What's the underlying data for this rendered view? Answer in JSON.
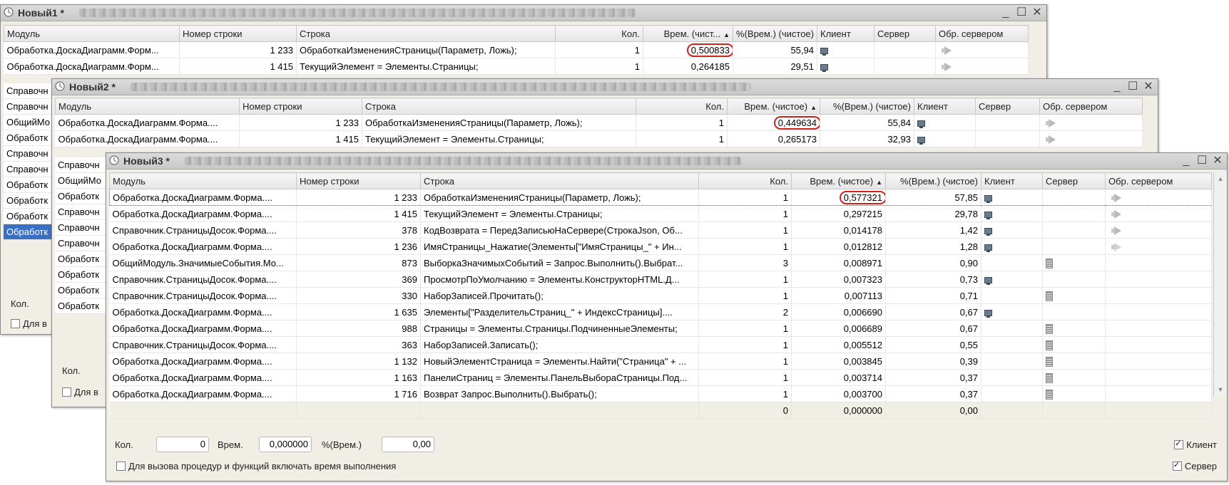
{
  "columns": [
    "Модуль",
    "Номер строки",
    "Строка",
    "Кол.",
    "Врем. (чистое)",
    "%(Врем.) (чистое)",
    "Клиент",
    "Сервер",
    "Обр. сервером"
  ],
  "columns_w1": [
    "Модуль",
    "Номер строки",
    "Строка",
    "Кол.",
    "Врем. (чист...",
    "%(Врем.) (чистое)",
    "Клиент",
    "Сервер",
    "Обр. сервером"
  ],
  "window1": {
    "title": "Новый1 *",
    "rows": [
      {
        "module": "Обработка.ДоскаДиаграмм.Форм...",
        "line": "1 233",
        "code": "ОбработкаИзмененияСтраницы(Параметр, Ложь);",
        "count": "1",
        "time": "0,500833",
        "pct": "55,94",
        "client": true,
        "srv": "arrow"
      },
      {
        "module": "Обработка.ДоскаДиаграмм.Форм...",
        "line": "1 415",
        "code": "ТекущийЭлемент = Элементы.Страницы;",
        "count": "1",
        "time": "0,264185",
        "pct": "29,51",
        "client": true,
        "srv": "arrow"
      }
    ],
    "left_items": [
      "Справочн",
      "Справочн",
      "ОбщийМо",
      "Обработк",
      "Справочн",
      "Справочн",
      "Обработк",
      "Обработк",
      "Обработк",
      "Обработк"
    ],
    "footer_label": "Кол.",
    "footer_checkbox": "Для в"
  },
  "window2": {
    "title": "Новый2 *",
    "rows": [
      {
        "module": "Обработка.ДоскаДиаграмм.Форма....",
        "line": "1 233",
        "code": "ОбработкаИзмененияСтраницы(Параметр, Ложь);",
        "count": "1",
        "time": "0,449634",
        "pct": "55,84",
        "client": true,
        "srv": "arrow"
      },
      {
        "module": "Обработка.ДоскаДиаграмм.Форма....",
        "line": "1 415",
        "code": "ТекущийЭлемент = Элементы.Страницы;",
        "count": "1",
        "time": "0,265173",
        "pct": "32,93",
        "client": true,
        "srv": "arrow"
      }
    ],
    "left_items": [
      "Справочн",
      "ОбщийМо",
      "Обработк",
      "Справочн",
      "Справочн",
      "Справочн",
      "Обработк",
      "Обработк",
      "Обработк",
      "Обработк"
    ],
    "footer_label": "Кол.",
    "footer_checkbox": "Для в"
  },
  "window3": {
    "title": "Новый3 *",
    "rows": [
      {
        "module": "Обработка.ДоскаДиаграмм.Форма....",
        "line": "1 233",
        "code": "ОбработкаИзмененияСтраницы(Параметр, Ложь);",
        "count": "1",
        "time": "0,577321",
        "pct": "57,85",
        "client": true,
        "srv": "arrow"
      },
      {
        "module": "Обработка.ДоскаДиаграмм.Форма....",
        "line": "1 415",
        "code": "ТекущийЭлемент = Элементы.Страницы;",
        "count": "1",
        "time": "0,297215",
        "pct": "29,78",
        "client": true,
        "srv": "arrow"
      },
      {
        "module": "Справочник.СтраницыДосок.Форма....",
        "line": "378",
        "code": "КодВозврата = ПередЗаписьюНаСервере(СтрокаJson, Об...",
        "count": "1",
        "time": "0,014178",
        "pct": "1,42",
        "client": true,
        "srv": "arrow"
      },
      {
        "module": "Обработка.ДоскаДиаграмм.Форма....",
        "line": "1 236",
        "code": "ИмяСтраницы_Нажатие(Элементы[\"ИмяСтраницы_\" + Ин...",
        "count": "1",
        "time": "0,012812",
        "pct": "1,28",
        "client": true,
        "srv": "arrow-light"
      },
      {
        "module": "ОбщийМодуль.ЗначимыеСобытия.Мо...",
        "line": "873",
        "code": "ВыборкаЗначимыхСобытий = Запрос.Выполнить().Выбрат...",
        "count": "3",
        "time": "0,008971",
        "pct": "0,90",
        "client": false,
        "srv": "server"
      },
      {
        "module": "Справочник.СтраницыДосок.Форма....",
        "line": "369",
        "code": "ПросмотрПоУмолчанию = Элементы.КонструкторHTML.Д...",
        "count": "1",
        "time": "0,007323",
        "pct": "0,73",
        "client": true,
        "srv": ""
      },
      {
        "module": "Справочник.СтраницыДосок.Форма....",
        "line": "330",
        "code": "НаборЗаписей.Прочитать();",
        "count": "1",
        "time": "0,007113",
        "pct": "0,71",
        "client": false,
        "srv": "server"
      },
      {
        "module": "Обработка.ДоскаДиаграмм.Форма....",
        "line": "1 635",
        "code": "Элементы[\"РазделительСтраниц_\"   + ИндексСтраницы]....",
        "count": "2",
        "time": "0,006690",
        "pct": "0,67",
        "client": true,
        "srv": ""
      },
      {
        "module": "Обработка.ДоскаДиаграмм.Форма....",
        "line": "988",
        "code": "Страницы = Элементы.Страницы.ПодчиненныеЭлементы;",
        "count": "1",
        "time": "0,006689",
        "pct": "0,67",
        "client": false,
        "srv": "server"
      },
      {
        "module": "Справочник.СтраницыДосок.Форма....",
        "line": "363",
        "code": "НаборЗаписей.Записать();",
        "count": "1",
        "time": "0,005512",
        "pct": "0,55",
        "client": false,
        "srv": "server"
      },
      {
        "module": "Обработка.ДоскаДиаграмм.Форма....",
        "line": "1 132",
        "code": "НовыйЭлементСтраница = Элементы.Найти(\"Страница\" + ...",
        "count": "1",
        "time": "0,003845",
        "pct": "0,39",
        "client": false,
        "srv": "server"
      },
      {
        "module": "Обработка.ДоскаДиаграмм.Форма....",
        "line": "1 163",
        "code": "ПанелиСтраниц = Элементы.ПанельВыбораСтраницы.Под...",
        "count": "1",
        "time": "0,003714",
        "pct": "0,37",
        "client": false,
        "srv": "server"
      },
      {
        "module": "Обработка.ДоскаДиаграмм.Форма....",
        "line": "1 716",
        "code": "Возврат Запрос.Выполнить().Выбрать();",
        "count": "1",
        "time": "0,003700",
        "pct": "0,37",
        "client": false,
        "srv": "server"
      }
    ],
    "totals": {
      "count": "0",
      "time": "0,000000",
      "pct": "0,00"
    },
    "footer": {
      "count_label": "Кол.",
      "count_value": "0",
      "time_label": "Врем.",
      "time_value": "0,000000",
      "pct_label": "%(Врем.)",
      "pct_value": "0,00",
      "include_checkbox": "Для вызова процедур и функций включать время выполнения",
      "client_checkbox": "Клиент",
      "server_checkbox": "Сервер"
    }
  },
  "colors": {
    "highlight": "#d0201c",
    "selection": "#3a6fc4"
  }
}
